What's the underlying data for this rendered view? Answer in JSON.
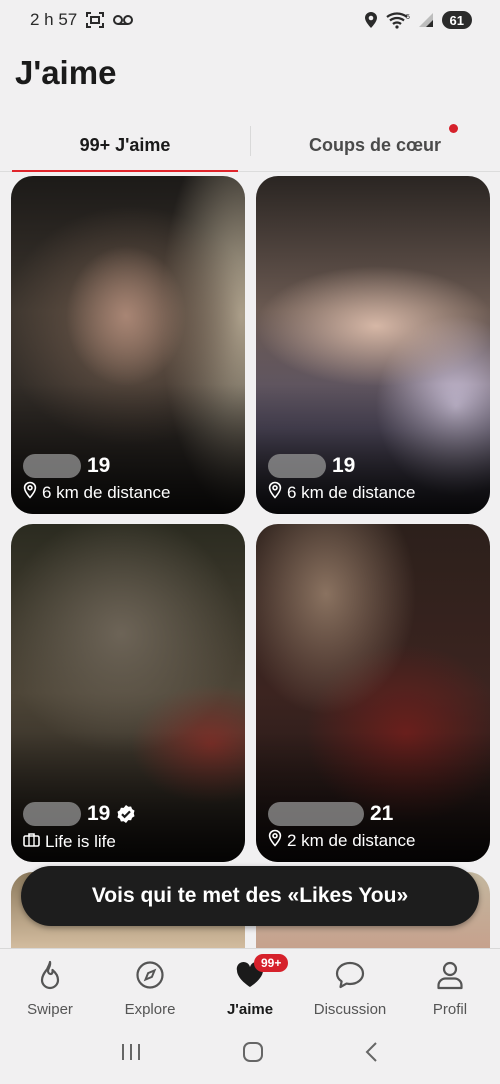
{
  "status_bar": {
    "time": "2 h 57",
    "battery": "61"
  },
  "page": {
    "title": "J'aime"
  },
  "tabs": [
    {
      "label": "99+ J'aime",
      "active": true
    },
    {
      "label": "Coups de cœur",
      "active": false,
      "has_notification_dot": true
    }
  ],
  "cards": [
    {
      "age": "19",
      "info": "6 km de distance",
      "info_icon": "location-pin-icon",
      "verified": false
    },
    {
      "age": "19",
      "info": "6 km de distance",
      "info_icon": "location-pin-icon",
      "verified": false
    },
    {
      "age": "19",
      "info": "Life is life",
      "info_icon": "briefcase-icon",
      "verified": true
    },
    {
      "age": "21",
      "info": "2 km de distance",
      "info_icon": "location-pin-icon",
      "verified": false
    }
  ],
  "promo": {
    "label": "Vois qui te met des «Likes You»"
  },
  "bottom_nav": {
    "items": [
      {
        "label": "Swiper",
        "icon": "flame-icon"
      },
      {
        "label": "Explore",
        "icon": "compass-icon"
      },
      {
        "label": "J'aime",
        "icon": "heart-icon",
        "badge": "99+",
        "active": true
      },
      {
        "label": "Discussion",
        "icon": "chat-bubble-icon"
      },
      {
        "label": "Profil",
        "icon": "person-icon"
      }
    ]
  },
  "colors": {
    "accent": "#d6212b",
    "background": "#f1f0f1",
    "promo_bg": "#1d1d1d"
  }
}
